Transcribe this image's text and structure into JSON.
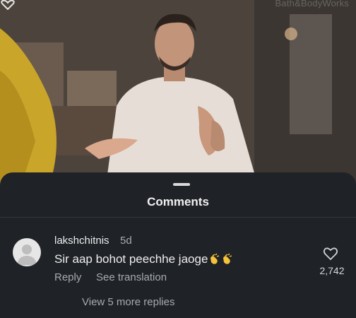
{
  "video": {
    "watermark": "Bath&BodyWorks"
  },
  "sheet": {
    "title": "Comments"
  },
  "comment": {
    "username": "lakshchitnis",
    "age": "5d",
    "text": "Sir aap bohot peechhe jaoge",
    "emoji": [
      "clapping-hands",
      "clapping-hands"
    ],
    "reply_label": "Reply",
    "translate_label": "See translation",
    "like_count": "2,742",
    "more_replies_label": "View 5 more replies"
  },
  "colors": {
    "sheet_background": "#1f2227",
    "primary_text": "#ededed",
    "secondary_text": "#a7abb1",
    "emoji_yellow": "#f5c23a"
  }
}
